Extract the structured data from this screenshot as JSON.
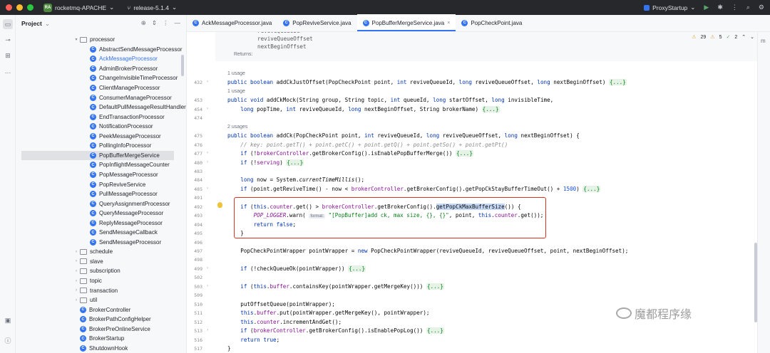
{
  "titlebar": {
    "project_badge": "RA",
    "project": "rocketmq-APACHE",
    "branch": "release-5.1.4",
    "run_config": "ProxyStartup"
  },
  "project_panel": {
    "title": "Project",
    "tree": [
      {
        "label": "processor",
        "kind": "folder",
        "depth": 5,
        "arrow": "open"
      },
      {
        "label": "AbstractSendMessageProcessor",
        "kind": "class",
        "depth": 6
      },
      {
        "label": "AckMessageProcessor",
        "kind": "class",
        "depth": 6,
        "link": true
      },
      {
        "label": "AdminBrokerProcessor",
        "kind": "class",
        "depth": 6
      },
      {
        "label": "ChangeInvisibleTimeProcessor",
        "kind": "class",
        "depth": 6
      },
      {
        "label": "ClientManageProcessor",
        "kind": "class",
        "depth": 6
      },
      {
        "label": "ConsumerManageProcessor",
        "kind": "class",
        "depth": 6
      },
      {
        "label": "DefaultPullMessageResultHandler",
        "kind": "class",
        "depth": 6
      },
      {
        "label": "EndTransactionProcessor",
        "kind": "class",
        "depth": 6
      },
      {
        "label": "NotificationProcessor",
        "kind": "class",
        "depth": 6
      },
      {
        "label": "PeekMessageProcessor",
        "kind": "class",
        "depth": 6
      },
      {
        "label": "PollingInfoProcessor",
        "kind": "class",
        "depth": 6
      },
      {
        "label": "PopBufferMergeService",
        "kind": "class",
        "depth": 6,
        "selected": true
      },
      {
        "label": "PopInflightMessageCounter",
        "kind": "class",
        "depth": 6
      },
      {
        "label": "PopMessageProcessor",
        "kind": "class",
        "depth": 6
      },
      {
        "label": "PopReviveService",
        "kind": "class",
        "depth": 6
      },
      {
        "label": "PullMessageProcessor",
        "kind": "class",
        "depth": 6
      },
      {
        "label": "QueryAssignmentProcessor",
        "kind": "class",
        "depth": 6
      },
      {
        "label": "QueryMessageProcessor",
        "kind": "class",
        "depth": 6
      },
      {
        "label": "ReplyMessageProcessor",
        "kind": "class",
        "depth": 6
      },
      {
        "label": "SendMessageCallback",
        "kind": "class",
        "depth": 6
      },
      {
        "label": "SendMessageProcessor",
        "kind": "class",
        "depth": 6
      },
      {
        "label": "schedule",
        "kind": "folder",
        "depth": 5,
        "arrow": "closed"
      },
      {
        "label": "slave",
        "kind": "folder",
        "depth": 5,
        "arrow": "closed"
      },
      {
        "label": "subscription",
        "kind": "folder",
        "depth": 5,
        "arrow": "closed"
      },
      {
        "label": "topic",
        "kind": "folder",
        "depth": 5,
        "arrow": "closed"
      },
      {
        "label": "transaction",
        "kind": "folder",
        "depth": 5,
        "arrow": "closed"
      },
      {
        "label": "util",
        "kind": "folder",
        "depth": 5,
        "arrow": "closed"
      },
      {
        "label": "BrokerController",
        "kind": "class",
        "depth": 5
      },
      {
        "label": "BrokerPathConfigHelper",
        "kind": "class",
        "depth": 5
      },
      {
        "label": "BrokerPreOnlineService",
        "kind": "class",
        "depth": 5
      },
      {
        "label": "BrokerStartup",
        "kind": "class",
        "depth": 5
      },
      {
        "label": "ShutdownHook",
        "kind": "class",
        "depth": 5
      }
    ]
  },
  "tabs": [
    {
      "label": "AckMessageProcessor.java",
      "active": false
    },
    {
      "label": "PopReviveService.java",
      "active": false
    },
    {
      "label": "PopBufferMergeService.java",
      "active": true
    },
    {
      "label": "PopCheckPoint.java",
      "active": false
    }
  ],
  "inspections": {
    "warnings": "29",
    "weak_warnings": "5",
    "ok": "2"
  },
  "doc": {
    "params": [
      "reviveQueueId",
      "reviveQueueOffset",
      "nextBeginOffset"
    ],
    "returns_label": "Returns:"
  },
  "editor_lines": [
    {
      "kind": "usage",
      "text": "1 usage"
    },
    {
      "kind": "code",
      "ln": "432",
      "fold": "›",
      "html_key": "l432"
    },
    {
      "kind": "usage",
      "text": "1 usage"
    },
    {
      "kind": "code",
      "ln": "453",
      "html_key": "l453"
    },
    {
      "kind": "code",
      "ln": "454",
      "fold": "›",
      "html_key": "l454"
    },
    {
      "kind": "code",
      "ln": "474",
      "html_key": "blank"
    },
    {
      "kind": "usage",
      "text": "2 usages"
    },
    {
      "kind": "code",
      "ln": "475",
      "html_key": "l475"
    },
    {
      "kind": "code",
      "ln": "476",
      "html_key": "l476"
    },
    {
      "kind": "code",
      "ln": "477",
      "fold": "›",
      "html_key": "l477"
    },
    {
      "kind": "code",
      "ln": "480",
      "fold": "›",
      "html_key": "l480"
    },
    {
      "kind": "code",
      "ln": "483",
      "html_key": "blank"
    },
    {
      "kind": "code",
      "ln": "484",
      "html_key": "l484"
    },
    {
      "kind": "code",
      "ln": "485",
      "fold": "›",
      "html_key": "l485"
    },
    {
      "kind": "code",
      "ln": "491",
      "html_key": "blank"
    },
    {
      "kind": "code",
      "ln": "492",
      "html_key": "l492"
    },
    {
      "kind": "code",
      "ln": "493",
      "html_key": "l493"
    },
    {
      "kind": "code",
      "ln": "494",
      "html_key": "l494"
    },
    {
      "kind": "code",
      "ln": "495",
      "html_key": "l495"
    },
    {
      "kind": "code",
      "ln": "496",
      "html_key": "blank"
    },
    {
      "kind": "code",
      "ln": "497",
      "html_key": "l497"
    },
    {
      "kind": "code",
      "ln": "498",
      "html_key": "blank"
    },
    {
      "kind": "code",
      "ln": "499",
      "fold": "›",
      "html_key": "l499"
    },
    {
      "kind": "code",
      "ln": "502",
      "html_key": "blank"
    },
    {
      "kind": "code",
      "ln": "503",
      "fold": "›",
      "html_key": "l503"
    },
    {
      "kind": "code",
      "ln": "509",
      "html_key": "blank"
    },
    {
      "kind": "code",
      "ln": "510",
      "html_key": "l510"
    },
    {
      "kind": "code",
      "ln": "511",
      "html_key": "l511"
    },
    {
      "kind": "code",
      "ln": "512",
      "html_key": "l512"
    },
    {
      "kind": "code",
      "ln": "513",
      "fold": "›",
      "html_key": "l513"
    },
    {
      "kind": "code",
      "ln": "516",
      "html_key": "l516"
    },
    {
      "kind": "code",
      "ln": "517",
      "html_key": "l517"
    }
  ],
  "code_text": {
    "l432": "public boolean addCkJustOffset(PopCheckPoint point, int reviveQueueId, long reviveQueueOffset, long nextBeginOffset) {...}",
    "l453": "public void addCkMock(String group, String topic, int queueId, long startOffset, long invisibleTime,",
    "l454": "    long popTime, int reviveQueueId, long nextBeginOffset, String brokerName) {...}",
    "l475": "public boolean addCk(PopCheckPoint point, int reviveQueueId, long reviveQueueOffset, long nextBeginOffset) {",
    "l476": "    // key: point.getT() + point.getC() + point.getQ() + point.getSo() + point.getPt()",
    "l477": "    if (!brokerController.getBrokerConfig().isEnablePopBufferMerge()) {...}",
    "l480": "    if (!serving) {...}",
    "l484": "    long now = System.currentTimeMillis();",
    "l485": "    if (point.getReviveTime() - now < brokerController.getBrokerConfig().getPopCkStayBufferTimeOut() + 1500) {...}",
    "l492": "    if (this.counter.get() > brokerController.getBrokerConfig().getPopCkMaxBufferSize()) {",
    "l493": "        POP_LOGGER.warn( format: \"[PopBuffer]add ck, max size, {}, {}\", point, this.counter.get());",
    "l494": "        return false;",
    "l495": "    }",
    "l497": "    PopCheckPointWrapper pointWrapper = new PopCheckPointWrapper(reviveQueueId, reviveQueueOffset, point, nextBeginOffset);",
    "l499": "    if (!checkQueueOk(pointWrapper)) {...}",
    "l503": "    if (this.buffer.containsKey(pointWrapper.getMergeKey())) {...}",
    "l510": "    putOffsetQueue(pointWrapper);",
    "l511": "    this.buffer.put(pointWrapper.getMergeKey(), pointWrapper);",
    "l512": "    this.counter.incrementAndGet();",
    "l513": "    if (brokerController.getBrokerConfig().isEnablePopLog()) {...}",
    "l516": "    return true;",
    "l517": "}"
  },
  "watermark": {
    "text": "魔都程序缘"
  },
  "colors": {
    "accent": "#3574f0",
    "highlight_box": "#d6341e",
    "keyword": "#0033b3",
    "field": "#871094"
  }
}
